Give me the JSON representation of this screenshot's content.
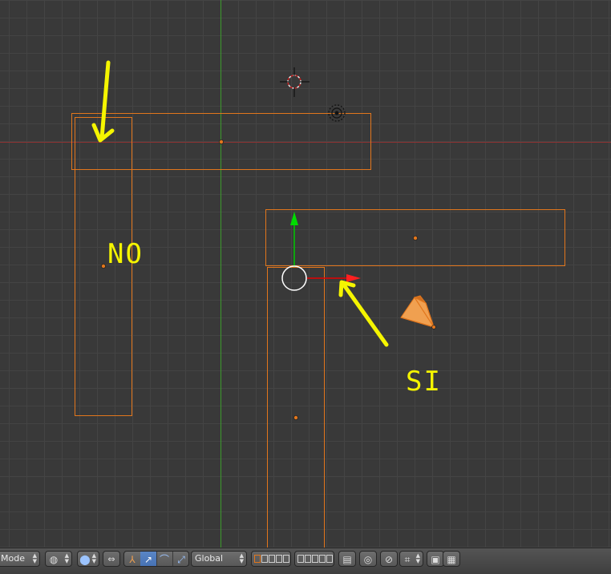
{
  "viewport": {
    "annotations": {
      "no_label": "NO",
      "si_label": "SI"
    },
    "colors": {
      "selected_outline": "#e2761c",
      "annotation": "#f5f500",
      "axis_x": "#9c3030",
      "axis_y": "#3c9a2c",
      "manip_x": "#e60000",
      "manip_y": "#00c800"
    }
  },
  "header": {
    "mode_select": {
      "value": "Mode"
    },
    "shading_icon": "sphere-icon",
    "pivot_icon": "pivot-icon",
    "manipulator_icons": [
      "axis-manipulator-icon",
      "translate-icon",
      "rotate-icon",
      "scale-icon"
    ],
    "orientation_select": {
      "value": "Global"
    },
    "layer_icons": [
      "layers-grid-icon"
    ],
    "extra_icons": [
      "layer-lock-icon",
      "proportional-edit-icon",
      "snap-icon",
      "snap-target-icon",
      "render-icon",
      "clapboard-icon"
    ]
  }
}
